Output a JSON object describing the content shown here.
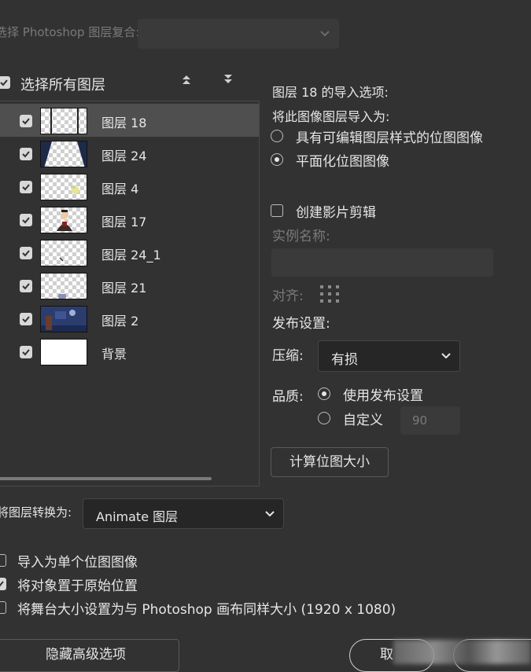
{
  "composite": {
    "label": "选择 Photoshop 图层复合:",
    "value": ""
  },
  "select_all": {
    "label": "选择所有图层",
    "checked": true
  },
  "layers": [
    {
      "name": "图层 18",
      "checked": true,
      "selected": true
    },
    {
      "name": "图层 24",
      "checked": true,
      "selected": false
    },
    {
      "name": "图层 4",
      "checked": true,
      "selected": false
    },
    {
      "name": "图层 17",
      "checked": true,
      "selected": false
    },
    {
      "name": "图层 24_1",
      "checked": true,
      "selected": false
    },
    {
      "name": "图层 21",
      "checked": true,
      "selected": false
    },
    {
      "name": "图层 2",
      "checked": true,
      "selected": false
    },
    {
      "name": "背景",
      "checked": true,
      "selected": false
    }
  ],
  "options": {
    "title": "图层 18 的导入选项:",
    "import_as_label": "将此图像图层导入为:",
    "radio_editable": "具有可编辑图层样式的位图图像",
    "radio_flatten": "平面化位图图像",
    "create_clip": "创建影片剪辑",
    "instance_name_label": "实例名称:",
    "instance_name_value": "",
    "align_label": "对齐:",
    "publish_label": "发布设置:",
    "compression_label": "压缩:",
    "compression_value": "有损",
    "quality_label": "品质:",
    "quality_use_publish": "使用发布设置",
    "quality_custom": "自定义",
    "quality_value": "90",
    "calc_button": "计算位图大小"
  },
  "convert": {
    "label": "将图层转换为:",
    "value": "Animate 图层"
  },
  "bottom_options": [
    {
      "label": "导入为单个位图图像",
      "checked": false
    },
    {
      "label": "将对象置于原始位置",
      "checked": true
    },
    {
      "label": "将舞台大小设置为与 Photoshop 画布同样大小 (1920 x 1080)",
      "checked": false
    }
  ],
  "buttons": {
    "hide_advanced": "隐藏高级选项",
    "cancel": "取"
  },
  "colors": {
    "background": "#323232",
    "selected_row": "#4f4f4f",
    "field": "#262626"
  }
}
